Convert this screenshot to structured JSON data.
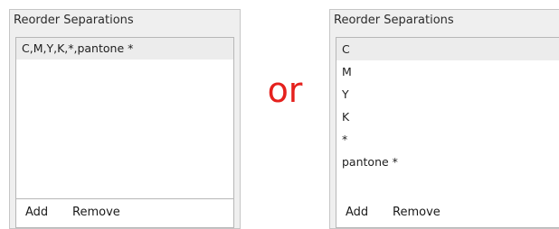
{
  "left_panel": {
    "title": "Reorder Separations",
    "items": [
      "C,M,Y,K,*,pantone *"
    ],
    "add_label": "Add",
    "remove_label": "Remove"
  },
  "separator": {
    "text": "or",
    "color": "#e5211d"
  },
  "right_panel": {
    "title": "Reorder Separations",
    "items": [
      "C",
      "M",
      "Y",
      "K",
      "*",
      "pantone *"
    ],
    "add_label": "Add",
    "remove_label": "Remove"
  }
}
